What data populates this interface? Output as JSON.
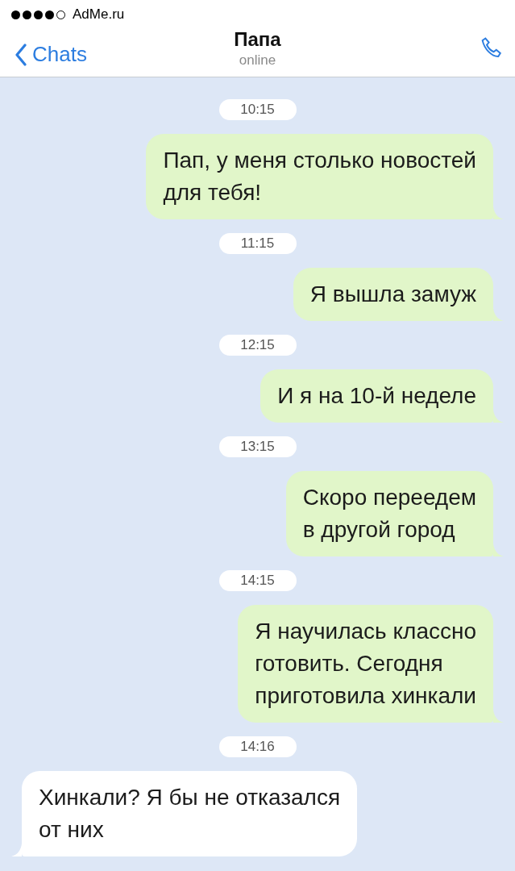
{
  "status_bar": {
    "signal_dots": [
      {
        "on": true
      },
      {
        "on": true
      },
      {
        "on": true
      },
      {
        "on": true
      },
      {
        "on": false
      }
    ],
    "carrier": "AdMe.ru"
  },
  "header": {
    "back": "Chats",
    "title": "Папа",
    "subtitle": "online"
  },
  "messages": [
    {
      "kind": "time",
      "text": "10:15"
    },
    {
      "kind": "outgoing",
      "text": "Пап, у меня столько новостей\nдля тебя!"
    },
    {
      "kind": "time",
      "text": "11:15"
    },
    {
      "kind": "outgoing",
      "text": "Я вышла замуж"
    },
    {
      "kind": "time",
      "text": "12:15"
    },
    {
      "kind": "outgoing",
      "text": "И я на 10-й неделе"
    },
    {
      "kind": "time",
      "text": "13:15"
    },
    {
      "kind": "outgoing",
      "text": "Скоро переедем\nв другой город"
    },
    {
      "kind": "time",
      "text": "14:15"
    },
    {
      "kind": "outgoing",
      "text": "Я научилась классно\nготовить. Сегодня\nприготовила хинкали"
    },
    {
      "kind": "time",
      "text": "14:16"
    },
    {
      "kind": "incoming",
      "text": "Хинкали? Я бы не отказался\nот них"
    }
  ]
}
